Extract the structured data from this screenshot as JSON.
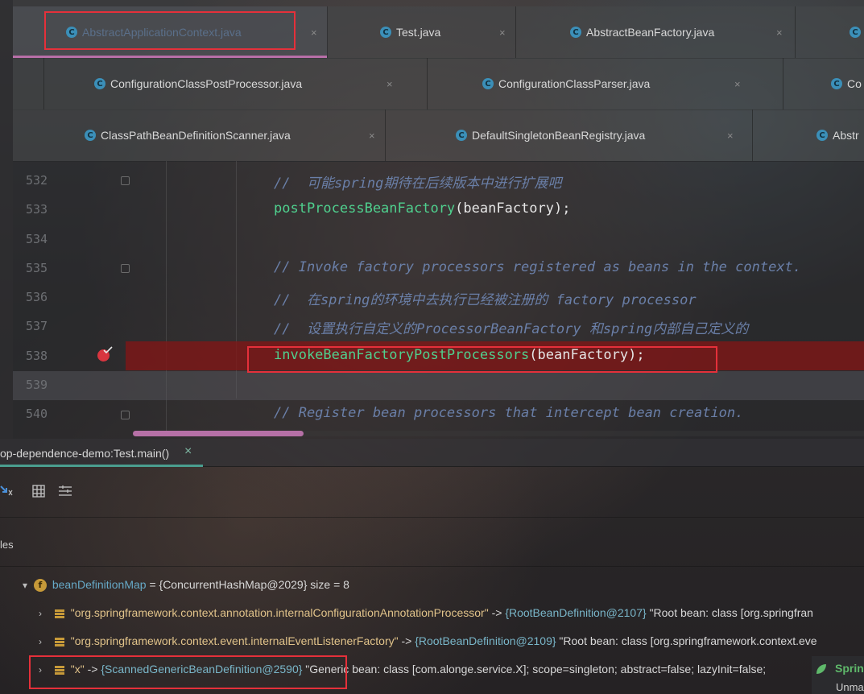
{
  "tabs_row1": [
    {
      "label": "AbstractApplicationContext.java",
      "active": true
    },
    {
      "label": "Test.java"
    },
    {
      "label": "AbstractBeanFactory.java"
    },
    {
      "label": ""
    }
  ],
  "tabs_row2": [
    {
      "label": "ConfigurationClassPostProcessor.java"
    },
    {
      "label": "ConfigurationClassParser.java"
    },
    {
      "label": "Co"
    }
  ],
  "tabs_row3": [
    {
      "label": "ClassPathBeanDefinitionScanner.java"
    },
    {
      "label": "DefaultSingletonBeanRegistry.java"
    },
    {
      "label": "Abstr"
    }
  ],
  "close_glyph": "×",
  "class_icon_glyph": "C",
  "editor": {
    "lines": [
      {
        "num": "532",
        "text": "//  可能spring期待在后续版本中进行扩展吧",
        "kind": "comment"
      },
      {
        "num": "533",
        "fn": "postProcessBeanFactory",
        "rest": "(beanFactory);",
        "kind": "call"
      },
      {
        "num": "534",
        "text": "",
        "kind": "blank"
      },
      {
        "num": "535",
        "text": "// Invoke factory processors registered as beans in the context.",
        "kind": "comment"
      },
      {
        "num": "536",
        "text": "//  在spring的环境中去执行已经被注册的 factory processor",
        "kind": "comment"
      },
      {
        "num": "537",
        "text": "//  设置执行自定义的ProcessorBeanFactory 和spring内部自己定义的",
        "kind": "comment"
      },
      {
        "num": "538",
        "fn": "invokeBeanFactoryPostProcessors",
        "rest": "(beanFactory);",
        "kind": "call",
        "breakpoint": true
      },
      {
        "num": "539",
        "text": "",
        "kind": "blank"
      },
      {
        "num": "540",
        "text": "// Register bean processors that intercept bean creation.",
        "kind": "comment"
      }
    ]
  },
  "debug": {
    "session_tab": "op-dependence-demo:Test.main()",
    "variables_label": "les",
    "tree": {
      "root": {
        "name": "beanDefinitionMap",
        "value": " = {ConcurrentHashMap@2029}  size = 8"
      },
      "entries": [
        {
          "key": "\"org.springframework.context.annotation.internalConfigurationAnnotationProcessor\"",
          "arrow": " -> ",
          "ref": "{RootBeanDefinition@2107}",
          "desc": " \"Root bean: class [org.springfran"
        },
        {
          "key": "\"org.springframework.context.event.internalEventListenerFactory\"",
          "arrow": " -> ",
          "ref": "{RootBeanDefinition@2109}",
          "desc": " \"Root bean: class [org.springframework.context.eve"
        },
        {
          "key": "\"x\"",
          "arrow": " -> ",
          "ref": "{ScannedGenericBeanDefinition@2590}",
          "desc": " \"Generic bean: class [com.alonge.service.X]; scope=singleton; abstract=false; lazyInit=false;"
        }
      ]
    },
    "side_label_spring": "Sprin",
    "side_label_unm": "Unma"
  },
  "colors": {
    "breakpoint_line": "#821616",
    "highlight_box": "#e5303a",
    "function": "#4fd08e",
    "comment": "#6a7fa8"
  }
}
